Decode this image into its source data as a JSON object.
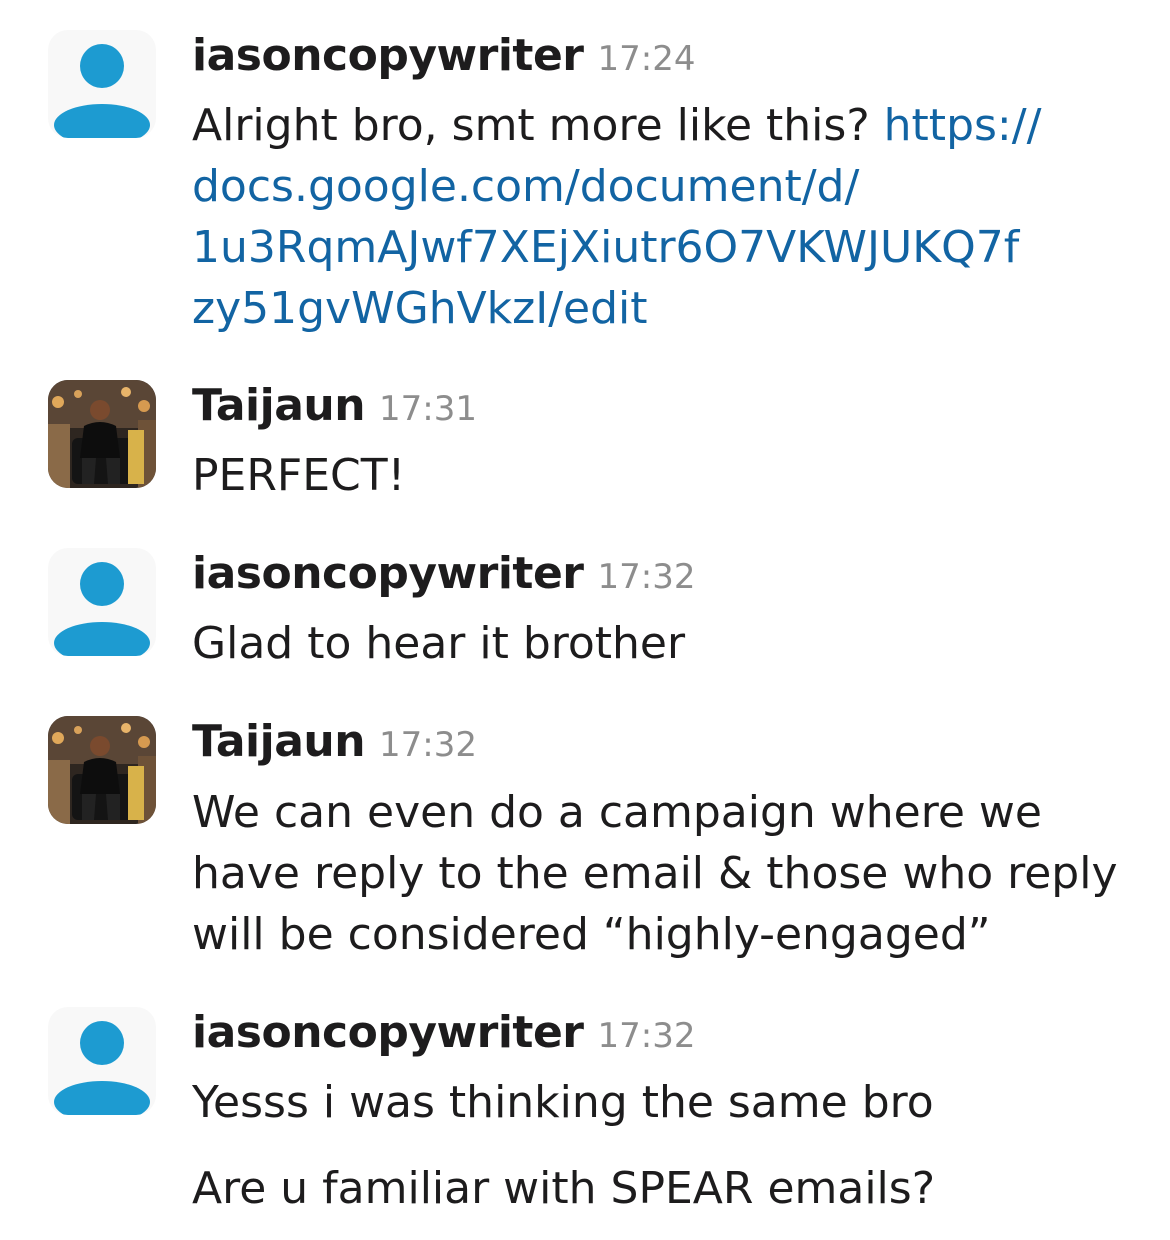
{
  "messages": [
    {
      "author": "iasoncopywriter",
      "time": "17:24",
      "avatar": "default-user-avatar",
      "text_prefix": "Alright bro, smt more like this? ",
      "link_lines": [
        "https://",
        "docs.google.com/document/d/",
        "1u3RqmAJwf7XEjXiutr6O7VKWJUKQ7f",
        "zy51gvWGhVkzI/edit"
      ]
    },
    {
      "author": "Taijaun",
      "time": "17:31",
      "avatar": "profile-photo",
      "lines": [
        "PERFECT!"
      ]
    },
    {
      "author": "iasoncopywriter",
      "time": "17:32",
      "avatar": "default-user-avatar",
      "lines": [
        "Glad to hear it brother"
      ]
    },
    {
      "author": "Taijaun",
      "time": "17:32",
      "avatar": "profile-photo",
      "lines": [
        "We can even do a campaign where we",
        "have reply to the email & those who reply",
        "will be considered “highly-engaged”"
      ]
    },
    {
      "author": "iasoncopywriter",
      "time": "17:32",
      "avatar": "default-user-avatar",
      "lines": [
        "Yesss i was thinking the same bro"
      ],
      "followup": "Are u familiar with SPEAR emails?"
    }
  ],
  "colors": {
    "link": "#1264a3",
    "default_avatar_icon": "#1d9bd1",
    "timestamp": "#8d8d8d"
  }
}
